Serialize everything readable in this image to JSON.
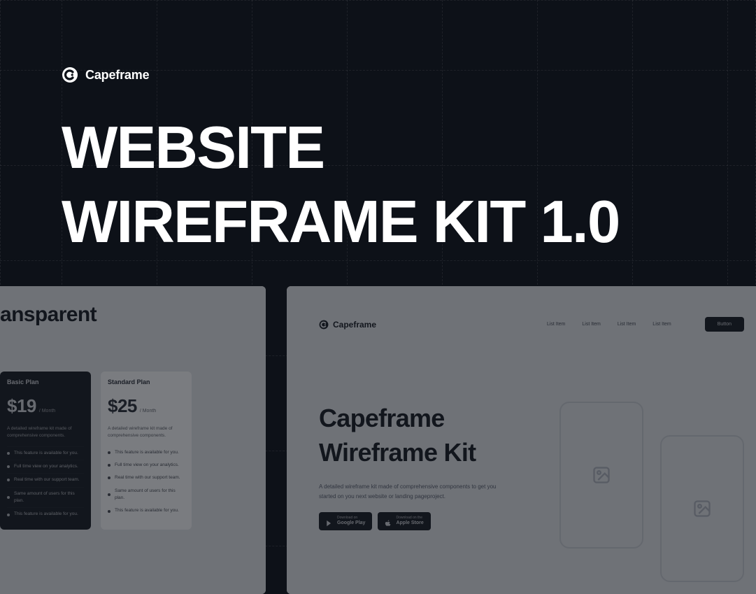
{
  "brand": {
    "name": "Capeframe"
  },
  "hero": {
    "title_line1": "WEBSITE",
    "title_line2": "WIREFRAME KIT 1.0"
  },
  "previews": {
    "pricing": {
      "heading_fragment": "ansparent",
      "plans": [
        {
          "name": "Basic Plan",
          "price": "$19",
          "period": "/ Month",
          "desc": "A detailed wireframe kit made of comprehensive components.",
          "features": [
            "This feature is available for you.",
            "Full time view on your analytics.",
            "Real time with our support team.",
            "Same amount of users for this plan.",
            "This feature is available for you."
          ]
        },
        {
          "name": "Standard Plan",
          "price": "$25",
          "period": "/ Month",
          "desc": "A detailed wireframe kit made of comprehensive components.",
          "features": [
            "This feature is available for you.",
            "Full time view on your analytics.",
            "Real time with our support team.",
            "Same amount of users for this plan.",
            "This feature is available for you."
          ]
        }
      ]
    },
    "wireframe": {
      "brand": "Capeframe",
      "nav_items": [
        "List Item",
        "List Item",
        "List Item",
        "List Item"
      ],
      "cta": "Button",
      "title_line1": "Capeframe",
      "title_line2": "Wireframe Kit",
      "subtitle": "A detailed wireframe kit made of comprehensive components to get you started on you next website or landing pageproject.",
      "stores": [
        {
          "top": "Download on",
          "bottom": "Google Play"
        },
        {
          "top": "Download on the",
          "bottom": "Apple Store"
        }
      ]
    }
  }
}
